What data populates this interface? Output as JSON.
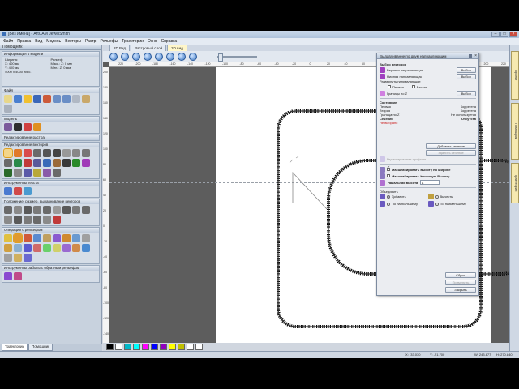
{
  "app": {
    "title": "[Без имени] - ArtCAM JewelSmith",
    "menu": [
      "Файл",
      "Правка",
      "Вид",
      "Модель",
      "Векторы",
      "Растр",
      "Рельефы",
      "Траектории",
      "Окно",
      "Справка"
    ]
  },
  "left_panel": {
    "title": "Помощник",
    "info_title": "Информация о модели",
    "info": {
      "col1": [
        "Ширина:",
        "X:  400 мм",
        "Y:  400 мм",
        "4000 x 4000 пикс."
      ],
      "col2": [
        "Рельеф:",
        "Макс.: Z: 0 мм",
        "Мин.: Z: 0 мм",
        ""
      ]
    },
    "sections": {
      "file": "Файл",
      "model": "Модель",
      "raster_edit": "Редактирование растра",
      "vector_edit": "Редактирование векторов",
      "text_tools": "Инструменты текста",
      "vector_ops": "Положение, размер, выравнивание векторов",
      "relief_ops": "Операции с рельефом",
      "relief_tools": "Инструменты работы с обратным рельефом"
    },
    "tabs": [
      "Траектории",
      "Помощник"
    ]
  },
  "document": {
    "tabs": [
      "2D Вид",
      "Растровый слой",
      "3D вид"
    ],
    "ruler_h": [
      "-220",
      "-200",
      "-180",
      "-160",
      "-140",
      "-120",
      "-100",
      "-80",
      "-60",
      "-40",
      "-20",
      "0",
      "20",
      "40",
      "60",
      "80",
      "100",
      "120",
      "140",
      "160",
      "180",
      "200",
      "220"
    ],
    "ruler_v": [
      "200",
      "180",
      "160",
      "140",
      "120",
      "100",
      "80",
      "60",
      "40",
      "20",
      "0",
      "-20",
      "-40",
      "-60",
      "-80",
      "-100",
      "-120",
      "-140"
    ]
  },
  "dialog": {
    "title": "Выдавливание по двум направляющим",
    "select_vectors": "Выбор векторов",
    "upper_guide": "Верхняя направляющая",
    "lower_guide": "Нижняя направляющая",
    "select_btn": "Выбор",
    "reverse_guides": "Развернуть направляющие",
    "first": "Первая",
    "second": "Вторая",
    "z_bounds": "Границы по Z",
    "status_title": "Состояние",
    "status": [
      {
        "label": "Первая",
        "value": "Корректна"
      },
      {
        "label": "Вторая",
        "value": "Корректна"
      },
      {
        "label": "Граница по Z",
        "value": "Не используется"
      }
    ],
    "sections_label": "Сечения",
    "sections_value": "Отсутств",
    "not_selected": "Не выбрано",
    "add_section": "Добавить сечение",
    "delete_section": "Удалить сечение",
    "edit_profile": "Редактирование профиля",
    "scale_width": "Масштабировать высоту по ширине",
    "scale_end": "Масштабировать Конечную Высоту",
    "start_height_label": "Начальная высота",
    "start_height_value": "1",
    "combine": "Объединить",
    "add": "Добавить",
    "subtract": "Вычесть",
    "max_combine": "По наибольшему",
    "min_combine": "По наименьшему",
    "apply": "Сброс",
    "cancel_disabled": "Применить",
    "close": "Закрыть"
  },
  "status_bar": {
    "x": "X: -33.030",
    "y": "Y: -21.700",
    "w": "W: 243.877",
    "h": "H: 270.840"
  },
  "right_strip": [
    "Проект",
    "Помощник",
    "Траектории"
  ],
  "palette_colors": [
    "#000000",
    "#ffffff",
    "#00b8c8",
    "#00ffff",
    "#ff00ff",
    "#0000ff",
    "#9000c0",
    "#ffff00",
    "#c0c000",
    "#ffffff",
    "#ffffff"
  ]
}
